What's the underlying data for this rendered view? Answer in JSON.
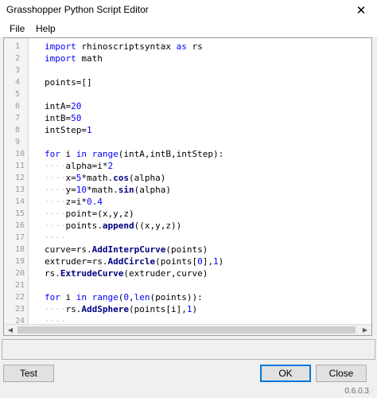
{
  "window": {
    "title": "Grasshopper Python Script Editor",
    "close_glyph": "✕"
  },
  "menu": [
    "File",
    "Help"
  ],
  "editor": {
    "line_numbers": [
      "1",
      "2",
      "3",
      "4",
      "5",
      "6",
      "7",
      "8",
      "9",
      "10",
      "11",
      "12",
      "13",
      "14",
      "15",
      "16",
      "17",
      "18",
      "19",
      "20",
      "21",
      "22",
      "23",
      "24"
    ],
    "lines": [
      [
        {
          "t": "import",
          "c": "kw"
        },
        {
          "t": " rhinoscriptsyntax "
        },
        {
          "t": "as",
          "c": "kw"
        },
        {
          "t": " rs"
        }
      ],
      [
        {
          "t": "import",
          "c": "kw"
        },
        {
          "t": " math"
        }
      ],
      [],
      [
        {
          "t": "points=[]"
        }
      ],
      [],
      [
        {
          "t": "intA="
        },
        {
          "t": "20",
          "c": "num"
        }
      ],
      [
        {
          "t": "intB="
        },
        {
          "t": "50",
          "c": "num"
        }
      ],
      [
        {
          "t": "intStep="
        },
        {
          "t": "1",
          "c": "num"
        }
      ],
      [],
      [
        {
          "t": "for",
          "c": "kw"
        },
        {
          "t": " i "
        },
        {
          "t": "in",
          "c": "kw"
        },
        {
          "t": " "
        },
        {
          "t": "range",
          "c": "kw"
        },
        {
          "t": "(intA,intB,intStep):"
        }
      ],
      [
        {
          "t": "····",
          "c": "ws"
        },
        {
          "t": "alpha=i*"
        },
        {
          "t": "2",
          "c": "num"
        }
      ],
      [
        {
          "t": "····",
          "c": "ws"
        },
        {
          "t": "x="
        },
        {
          "t": "5",
          "c": "num"
        },
        {
          "t": "*math."
        },
        {
          "t": "cos",
          "c": "fn"
        },
        {
          "t": "(alpha)"
        }
      ],
      [
        {
          "t": "····",
          "c": "ws"
        },
        {
          "t": "y="
        },
        {
          "t": "10",
          "c": "num"
        },
        {
          "t": "*math."
        },
        {
          "t": "sin",
          "c": "fn"
        },
        {
          "t": "(alpha)"
        }
      ],
      [
        {
          "t": "····",
          "c": "ws"
        },
        {
          "t": "z=i*"
        },
        {
          "t": "0.4",
          "c": "num"
        }
      ],
      [
        {
          "t": "····",
          "c": "ws"
        },
        {
          "t": "point=(x,y,z)"
        }
      ],
      [
        {
          "t": "····",
          "c": "ws"
        },
        {
          "t": "points."
        },
        {
          "t": "append",
          "c": "fn"
        },
        {
          "t": "((x,y,z))"
        }
      ],
      [
        {
          "t": "····",
          "c": "ws"
        }
      ],
      [
        {
          "t": "curve=rs."
        },
        {
          "t": "AddInterpCurve",
          "c": "fn"
        },
        {
          "t": "(points)"
        }
      ],
      [
        {
          "t": "extruder=rs."
        },
        {
          "t": "AddCircle",
          "c": "fn"
        },
        {
          "t": "(points["
        },
        {
          "t": "0",
          "c": "num"
        },
        {
          "t": "],"
        },
        {
          "t": "1",
          "c": "num"
        },
        {
          "t": ")"
        }
      ],
      [
        {
          "t": "rs."
        },
        {
          "t": "ExtrudeCurve",
          "c": "fn"
        },
        {
          "t": "(extruder,curve)"
        }
      ],
      [],
      [
        {
          "t": "for",
          "c": "kw"
        },
        {
          "t": " i "
        },
        {
          "t": "in",
          "c": "kw"
        },
        {
          "t": " "
        },
        {
          "t": "range",
          "c": "kw"
        },
        {
          "t": "("
        },
        {
          "t": "0",
          "c": "num"
        },
        {
          "t": ","
        },
        {
          "t": "len",
          "c": "kw"
        },
        {
          "t": "(points)):"
        }
      ],
      [
        {
          "t": "····",
          "c": "ws"
        },
        {
          "t": "rs."
        },
        {
          "t": "AddSphere",
          "c": "fn"
        },
        {
          "t": "(points[i],"
        },
        {
          "t": "1",
          "c": "num"
        },
        {
          "t": ")"
        }
      ],
      [
        {
          "t": "····",
          "c": "ws"
        }
      ]
    ],
    "scroll_left_glyph": "◀",
    "scroll_right_glyph": "▶"
  },
  "output": {
    "text": ""
  },
  "buttons": {
    "test": "Test",
    "ok": "OK",
    "close": "Close"
  },
  "version": "0.6.0.3",
  "colors": {
    "keyword": "#0000ff",
    "function": "#000080",
    "number": "#0000ff",
    "whitespace_marker": "#c8c8c8",
    "default_button_border": "#0078d7"
  }
}
